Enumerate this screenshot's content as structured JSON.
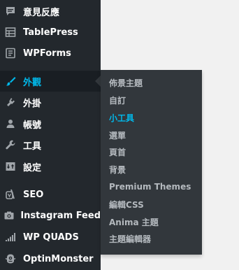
{
  "accent_color": "#00b9eb",
  "sidebar": {
    "items": [
      {
        "label": "意見反應",
        "icon": "comments-icon"
      },
      {
        "label": "TablePress",
        "icon": "table-icon"
      },
      {
        "label": "WPForms",
        "icon": "forms-icon"
      },
      {
        "label": "外觀",
        "icon": "paintbrush-icon",
        "active": true
      },
      {
        "label": "外掛",
        "icon": "plugins-icon"
      },
      {
        "label": "帳號",
        "icon": "user-icon"
      },
      {
        "label": "工具",
        "icon": "wrench-icon"
      },
      {
        "label": "設定",
        "icon": "settings-icon"
      },
      {
        "label": "SEO",
        "icon": "yoast-seo-icon"
      },
      {
        "label": "Instagram Feed",
        "icon": "camera-icon"
      },
      {
        "label": "WP QUADS",
        "icon": "signal-bars-icon"
      },
      {
        "label": "OptinMonster",
        "icon": "optinmonster-icon"
      }
    ]
  },
  "flyout": {
    "items": [
      {
        "label": "佈景主題"
      },
      {
        "label": "自訂"
      },
      {
        "label": "小工具",
        "current": true
      },
      {
        "label": "選單"
      },
      {
        "label": "頁首"
      },
      {
        "label": "背景"
      },
      {
        "label": "Premium Themes"
      },
      {
        "label": "編輯CSS"
      },
      {
        "label": "Anima 主題"
      },
      {
        "label": "主題編輯器"
      }
    ]
  }
}
